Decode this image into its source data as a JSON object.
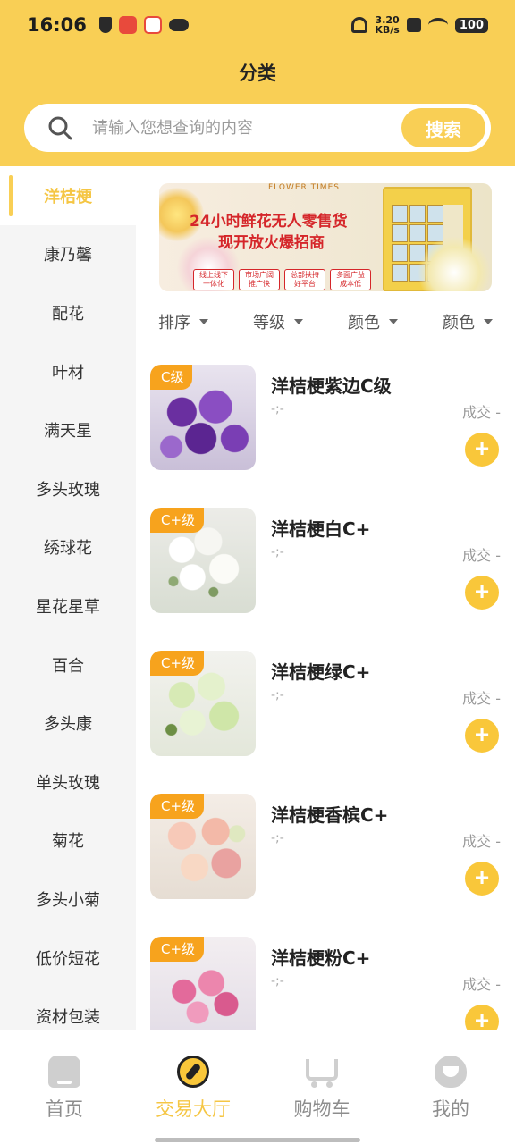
{
  "status_bar": {
    "time": "16:06",
    "net_speed_value": "3.20",
    "net_speed_unit": "KB/s",
    "battery": "100"
  },
  "header": {
    "title": "分类"
  },
  "search": {
    "placeholder": "请输入您想查询的内容",
    "button_label": "搜索"
  },
  "sidebar": {
    "items": [
      {
        "label": "洋桔梗",
        "active": true
      },
      {
        "label": "康乃馨"
      },
      {
        "label": "配花"
      },
      {
        "label": "叶材"
      },
      {
        "label": "满天星"
      },
      {
        "label": "多头玫瑰"
      },
      {
        "label": "绣球花"
      },
      {
        "label": "星花星草"
      },
      {
        "label": "百合"
      },
      {
        "label": "多头康"
      },
      {
        "label": "单头玫瑰"
      },
      {
        "label": "菊花"
      },
      {
        "label": "多头小菊"
      },
      {
        "label": "低价短花"
      },
      {
        "label": "资材包装"
      }
    ]
  },
  "banner": {
    "brand": "FLOWER TIMES",
    "line1": "24小时鲜花无人零售货",
    "line2": "现开放火爆招商",
    "tags": [
      "线上线下 一体化",
      "市场广阔 推广快",
      "总部扶持 好平台",
      "多面广益 成本低"
    ]
  },
  "filters": [
    {
      "label": "排序"
    },
    {
      "label": "等级"
    },
    {
      "label": "颜色"
    },
    {
      "label": "颜色"
    }
  ],
  "products": [
    {
      "name": "洋桔梗紫边C级",
      "grade": "C级",
      "price": "-;-",
      "deal": "成交 -",
      "picture": "purple-lisianthus"
    },
    {
      "name": "洋桔梗白C+",
      "grade": "C+级",
      "price": "-;-",
      "deal": "成交 -",
      "picture": "white-lisianthus"
    },
    {
      "name": "洋桔梗绿C+",
      "grade": "C+级",
      "price": "-;-",
      "deal": "成交 -",
      "picture": "green-lisianthus"
    },
    {
      "name": "洋桔梗香槟C+",
      "grade": "C+级",
      "price": "-;-",
      "deal": "成交 -",
      "picture": "champagne-lisianthus"
    },
    {
      "name": "洋桔梗粉C+",
      "grade": "C+级",
      "price": "-;-",
      "deal": "成交 -",
      "picture": "pink-lisianthus"
    }
  ],
  "bottom_nav": [
    {
      "label": "首页",
      "icon": "home-icon"
    },
    {
      "label": "交易大厅",
      "icon": "compass-icon",
      "active": true
    },
    {
      "label": "购物车",
      "icon": "cart-icon"
    },
    {
      "label": "我的",
      "icon": "profile-icon"
    }
  ],
  "colors": {
    "brand_yellow": "#f9cf55",
    "accent_text": "#f5c644",
    "badge_orange": "#f7a31d",
    "banner_red": "#d5262a"
  }
}
